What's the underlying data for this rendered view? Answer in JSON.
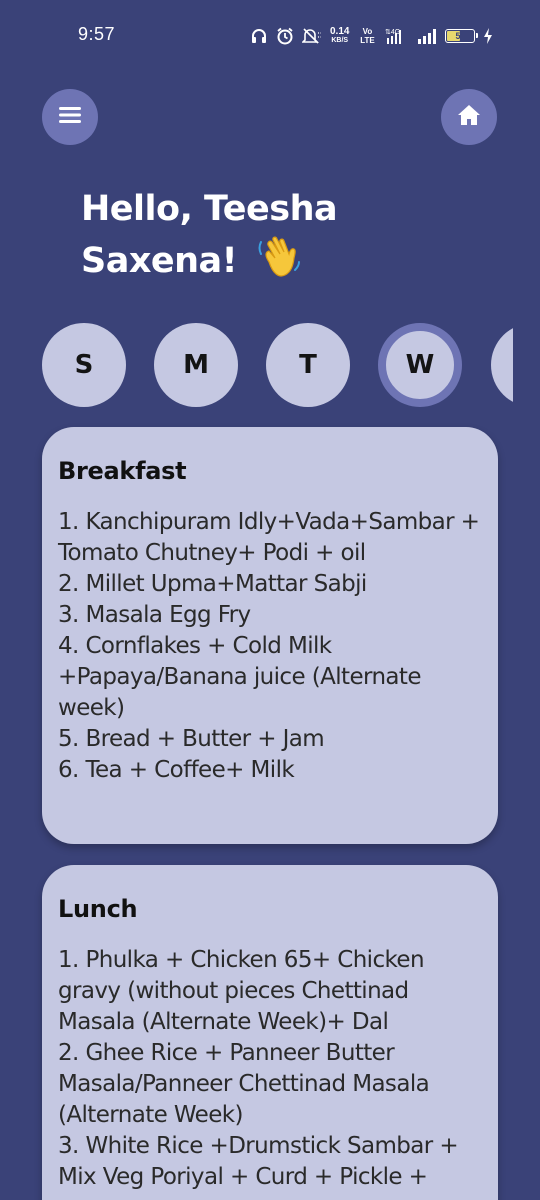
{
  "status_bar": {
    "time": "9:57",
    "net_speed_value": "0.14",
    "net_speed_unit": "KB/S",
    "volte_label": "Vo LTE",
    "network": "4G",
    "battery_level": "51",
    "battery_fraction": 0.51,
    "icons": [
      "headphones-icon",
      "alarm-icon",
      "mute-icon",
      "volte-icon",
      "signal-icon",
      "charging-icon"
    ]
  },
  "header": {
    "menu_icon": "hamburger-menu-icon",
    "home_icon": "home-icon"
  },
  "greeting": {
    "text": "Hello, Teesha Saxena!",
    "emoji": "👋"
  },
  "days": [
    {
      "label": "S",
      "selected": false
    },
    {
      "label": "M",
      "selected": false
    },
    {
      "label": "T",
      "selected": false
    },
    {
      "label": "W",
      "selected": true
    },
    {
      "label": "",
      "selected": false
    }
  ],
  "meals": {
    "breakfast": {
      "title": "Breakfast",
      "items": [
        "1. Kanchipuram Idly+Vada+Sambar + Tomato Chutney+ Podi + oil",
        "2. Millet Upma+Mattar Sabji",
        "3. Masala Egg Fry",
        "4. Cornflakes + Cold Milk +Papaya/Banana juice (Alternate week)",
        "5. Bread + Butter + Jam",
        "6. Tea + Coffee+ Milk"
      ]
    },
    "lunch": {
      "title": "Lunch",
      "items": [
        "1. Phulka + Chicken 65+ Chicken gravy (without pieces Chettinad Masala (Alternate Week)+ Dal",
        "2. Ghee Rice + Panneer Butter Masala/Panneer Chettinad Masala (Alternate Week)",
        "3. White Rice +Drumstick Sambar + Mix Veg Poriyal + Curd + Pickle +"
      ]
    }
  },
  "colors": {
    "background": "#3a4278",
    "button": "#6e74b4",
    "card": "#c5c8e2",
    "text_dark": "#111111",
    "text_light": "#ffffff"
  }
}
